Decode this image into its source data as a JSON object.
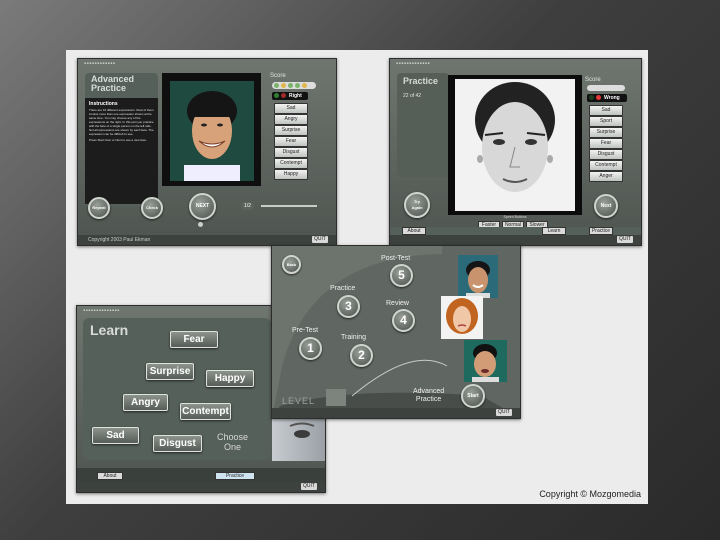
{
  "footer": {
    "copyright": "Copyright © Mozgomedia"
  },
  "advanced": {
    "title_l1": "Advanced",
    "title_l2": "Practice",
    "section": "Instructions",
    "paragraph1": "There are 16 different expressions. Most of them involve more than one expression shown at the same time. You may choose any of the expressions on the right. In this part you practice with the face of a single person on the left side. Not all expressions are shown by each face. The expression can be difficult to see.",
    "paragraph2": "Press Start Over or Next to see a new face.",
    "score_label": "Score",
    "result": "Right",
    "options": [
      "Sad",
      "Angry",
      "Surprise",
      "Fear",
      "Disgust",
      "Contempt",
      "Happy"
    ],
    "buttons": {
      "repeat": "Repeat",
      "check": "Check",
      "next": "NEXT"
    },
    "speed": "1/2",
    "bottom": "Copyright 2003 Paul Ekman",
    "quit": "QUIT"
  },
  "practice": {
    "title": "Practice",
    "counter": "22 of 42",
    "score_label": "Score",
    "result": "Wrong",
    "options": [
      "Sad",
      "Sport",
      "Surprise",
      "Fear",
      "Disgust",
      "Contempt",
      "Anger"
    ],
    "try_again_l1": "Try",
    "try_again_l2": "Again",
    "next": "Next",
    "speed_label": "Speed Buttons",
    "speeds": [
      "Faster",
      "Normal",
      "Slower"
    ],
    "tabs": [
      "About",
      "Learn",
      "Practice"
    ],
    "quit": "QUIT"
  },
  "learn": {
    "title": "Learn",
    "emotions": [
      "Fear",
      "Surprise",
      "Happy",
      "Angry",
      "Contempt",
      "Sad",
      "Disgust"
    ],
    "choose_l1": "Choose",
    "choose_l2": "One",
    "tabs": [
      "About",
      "Practice"
    ],
    "quit": "QUIT"
  },
  "menu": {
    "back": "Back",
    "pretest": "Pre-Test",
    "pretest_n": "1",
    "practice": "Practice",
    "practice_n": "3",
    "training": "Training",
    "training_n": "2",
    "review": "Review",
    "review_n": "4",
    "posttest": "Post-Test",
    "posttest_n": "5",
    "level": "LEVEL",
    "advanced_l1": "Advanced",
    "advanced_l2": "Practice",
    "start": "Start",
    "quit": "QUIT"
  },
  "colors": {
    "accent": "#5b625c",
    "right": "#2e7d32",
    "wrong": "#c62828"
  }
}
